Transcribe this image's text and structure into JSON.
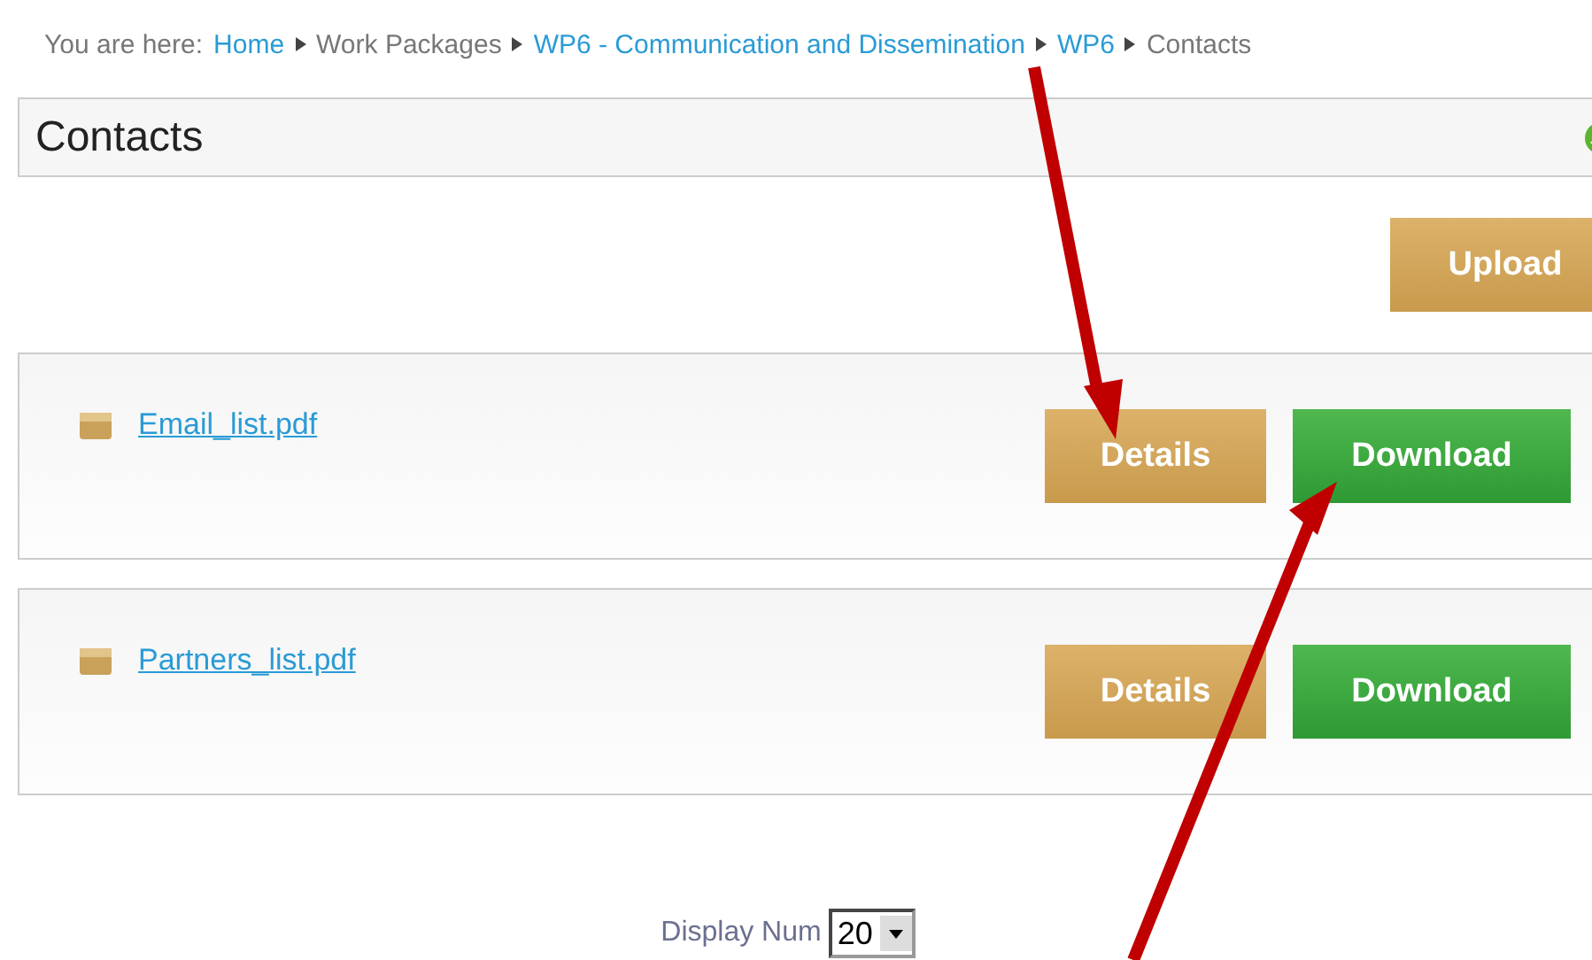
{
  "breadcrumb": {
    "label": "You are here:",
    "items": [
      {
        "text": "Home",
        "kind": "link"
      },
      {
        "text": "Work Packages",
        "kind": "text"
      },
      {
        "text": "WP6 - Communication and Dissemination",
        "kind": "link"
      },
      {
        "text": "WP6",
        "kind": "link"
      },
      {
        "text": "Contacts",
        "kind": "text"
      }
    ]
  },
  "panel": {
    "title": "Contacts"
  },
  "upload_button": "Upload",
  "files": [
    {
      "name": "Email_list.pdf",
      "details": "Details",
      "download": "Download"
    },
    {
      "name": "Partners_list.pdf",
      "details": "Details",
      "download": "Download"
    }
  ],
  "pager": {
    "label": "Display Num",
    "value": "20"
  }
}
